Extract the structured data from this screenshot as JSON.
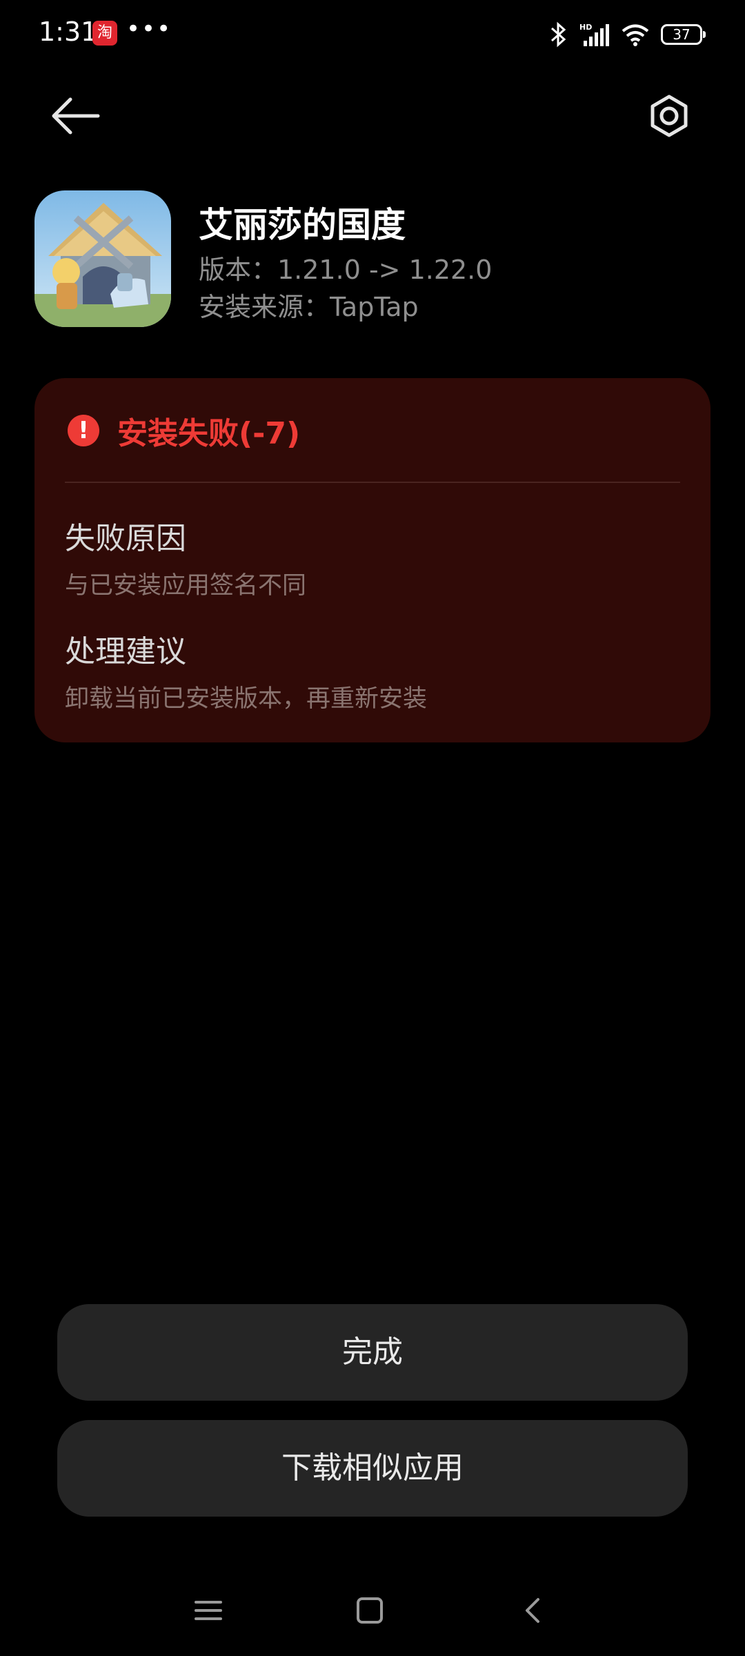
{
  "status_bar": {
    "time": "1:31",
    "notification_icon": "taobao-icon",
    "notification_glyph": "淘",
    "more_indicator": "•••",
    "battery_level": "37",
    "icons": [
      "bluetooth-icon",
      "hd-signal-icon",
      "wifi-icon",
      "battery-icon"
    ]
  },
  "toolbar": {
    "back_icon": "back-arrow-icon",
    "settings_icon": "settings-icon"
  },
  "app": {
    "name": "艾丽莎的国度",
    "version": "版本：1.21.0 -> 1.22.0",
    "source": "安装来源：TapTap"
  },
  "error": {
    "title": "安装失败(-7)",
    "icon_glyph": "!",
    "reason_title": "失败原因",
    "reason_text": "与已安装应用签名不同",
    "advice_title": "处理建议",
    "advice_text": "卸载当前已安装版本，再重新安装"
  },
  "buttons": {
    "done_label": "完成",
    "similar_label": "下载相似应用"
  },
  "nav_bar": {
    "icons": [
      "menu-icon",
      "home-icon",
      "back-icon"
    ]
  },
  "colors": {
    "background": "#000000",
    "error_red": "#ee3b36",
    "card_bg": "#300a07",
    "button_bg": "#252525"
  }
}
